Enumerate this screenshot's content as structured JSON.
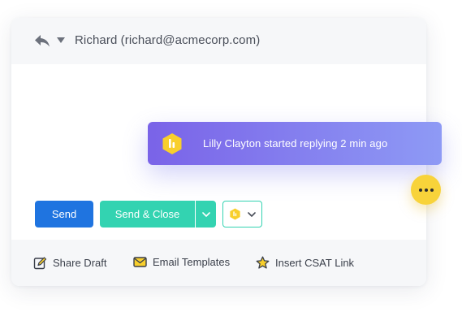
{
  "header": {
    "recipient": "Richard (richard@acmecorp.com)"
  },
  "actions": {
    "send_label": "Send",
    "send_close_label": "Send & Close"
  },
  "footer": {
    "items": [
      {
        "label": "Share Draft",
        "icon": "edit-icon"
      },
      {
        "label": "Email Templates",
        "icon": "envelope-icon"
      },
      {
        "label": "Insert CSAT Link",
        "icon": "star-icon"
      }
    ]
  },
  "notification": {
    "text": "Lilly Clayton started replying 2 min ago",
    "icon": "brand-logo-icon"
  },
  "colors": {
    "send": "#1f74e0",
    "send_close": "#33d3b1",
    "toast_start": "#7a63e8",
    "toast_end": "#8e9af5",
    "accent_yellow": "#f8d33a"
  }
}
